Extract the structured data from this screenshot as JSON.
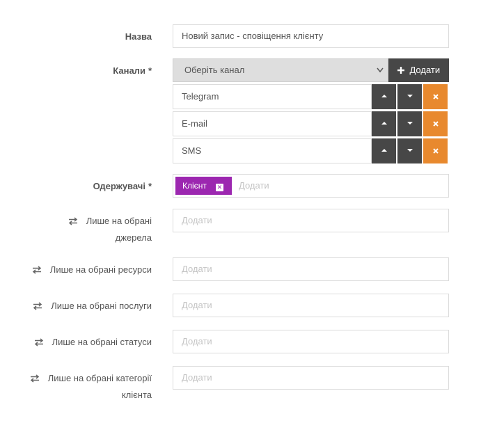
{
  "form": {
    "name_label": "Назва",
    "name_value": "Новий запис - сповіщення клієнту",
    "channels_label": "Канали",
    "required_mark": "*",
    "channel_select_placeholder": "Оберіть канал",
    "add_button_label": "Додати",
    "channels": [
      {
        "name": "Telegram"
      },
      {
        "name": "E-mail"
      },
      {
        "name": "SMS"
      }
    ],
    "recipients_label": "Одержувачі",
    "recipient_tags": [
      {
        "label": "Клієнт"
      }
    ],
    "recipients_placeholder": "Додати",
    "filters": [
      {
        "label_line1": "Лише на обрані",
        "label_line2": "джерела",
        "placeholder": "Додати"
      },
      {
        "label_line1": "Лише на обрані ресурси",
        "placeholder": "Додати"
      },
      {
        "label_line1": "Лише на обрані послуги",
        "placeholder": "Додати"
      },
      {
        "label_line1": "Лише на обрані статуси",
        "placeholder": "Додати"
      },
      {
        "label_line1": "Лише на обрані категорії",
        "label_line2": "клієнта",
        "placeholder": "Додати"
      }
    ]
  },
  "icons": {
    "swap": "swap-arrows-icon",
    "up": "caret-up-icon",
    "down": "caret-down-icon",
    "remove": "close-icon",
    "plus": "plus-icon",
    "chevron": "chevron-down-icon"
  },
  "colors": {
    "dark_button": "#474747",
    "remove_button": "#e8892e",
    "tag": "#9c27b0",
    "select_bg": "#dedede"
  }
}
